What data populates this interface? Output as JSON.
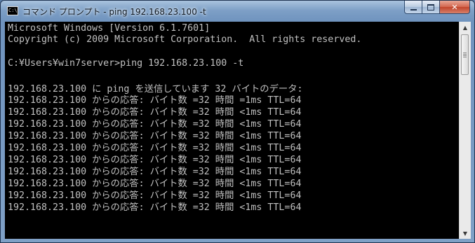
{
  "window": {
    "title": "コマンド プロンプト - ping  192.168.23.100 -t",
    "app_icon_text": "C:\\",
    "controls": {
      "minimize": "minimize",
      "maximize": "maximize",
      "close": "✕"
    }
  },
  "console": {
    "lines": [
      "Microsoft Windows [Version 6.1.7601]",
      "Copyright (c) 2009 Microsoft Corporation.  All rights reserved.",
      "",
      "C:¥Users¥win7server>ping 192.168.23.100 -t",
      "",
      "192.168.23.100 に ping を送信しています 32 バイトのデータ:",
      "192.168.23.100 からの応答: バイト数 =32 時間 =1ms TTL=64",
      "192.168.23.100 からの応答: バイト数 =32 時間 <1ms TTL=64",
      "192.168.23.100 からの応答: バイト数 =32 時間 <1ms TTL=64",
      "192.168.23.100 からの応答: バイト数 =32 時間 <1ms TTL=64",
      "192.168.23.100 からの応答: バイト数 =32 時間 <1ms TTL=64",
      "192.168.23.100 からの応答: バイト数 =32 時間 <1ms TTL=64",
      "192.168.23.100 からの応答: バイト数 =32 時間 <1ms TTL=64",
      "192.168.23.100 からの応答: バイト数 =32 時間 <1ms TTL=64",
      "192.168.23.100 からの応答: バイト数 =32 時間 <1ms TTL=64",
      "192.168.23.100 からの応答: バイト数 =32 時間 <1ms TTL=64"
    ],
    "text_color": "#c0c0c0",
    "background": "#000000"
  },
  "scrollbar": {
    "up_icon": "▲",
    "down_icon": "▼"
  }
}
